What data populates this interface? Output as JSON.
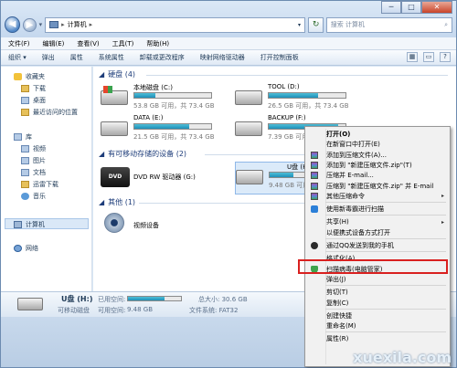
{
  "window": {
    "controls": {
      "minimize": "─",
      "maximize": "□",
      "close": "✕"
    }
  },
  "address": {
    "root": "▸",
    "path": "计算机",
    "arrow": "▾"
  },
  "search": {
    "placeholder": "搜索 计算机"
  },
  "menubar": [
    "文件(F)",
    "编辑(E)",
    "查看(V)",
    "工具(T)",
    "帮助(H)"
  ],
  "toolbar": [
    "组织 ▾",
    "弹出",
    "属性",
    "系统属性",
    "卸载或更改程序",
    "映射网络驱动器",
    "打开控制面板"
  ],
  "navpane": {
    "favorites": "收藏夹",
    "downloads": "下载",
    "desktop": "桌面",
    "recent": "最近访问的位置",
    "library": "库",
    "videos": "视频",
    "pictures": "图片",
    "docs": "文档",
    "xunlei": "迅雷下载",
    "music": "音乐",
    "computer": "计算机",
    "network": "网络"
  },
  "groups": {
    "hdd": "硬盘 (4)",
    "removable": "有可移动存储的设备 (2)",
    "other": "其他 (1)"
  },
  "drives": [
    {
      "name": "本地磁盘 (C:)",
      "size": "53.8 GB 可用，共 73.4 GB",
      "used": 0.27
    },
    {
      "name": "TOOL (D:)",
      "size": "26.5 GB 可用，共 73.4 GB",
      "used": 0.64
    },
    {
      "name": "DATA (E:)",
      "size": "21.5 GB 可用，共 73.4 GB",
      "used": 0.71
    },
    {
      "name": "BACKUP (F:)",
      "size": "7.39 GB 可用，",
      "used": 0.9
    }
  ],
  "removable": {
    "dvd": {
      "name": "DVD RW 驱动器 (G:)",
      "logo": "DVD"
    },
    "usb": {
      "name": "U盘 (H:)",
      "size": "9.48 GB 可用",
      "used": 0.31
    }
  },
  "other": {
    "webcam": "视频设备"
  },
  "details": {
    "name": "U盘 (H:)",
    "type": "可移动磁盘",
    "used_label": "已用空间:",
    "free_label": "可用空间:",
    "free_value": "9.48 GB",
    "total_label": "总大小: 30.6 GB",
    "fs_label": "文件系统: FAT32",
    "used_fraction": 0.69
  },
  "context_menu": [
    {
      "label": "打开(O)",
      "bold": true
    },
    {
      "label": "在新窗口中打开(E)"
    },
    {
      "label": "添加到压缩文件(A)...",
      "icon": "rar"
    },
    {
      "label": "添加到 \"新建压缩文件.zip\"(T)",
      "icon": "rar"
    },
    {
      "label": "压缩并 E-mail...",
      "icon": "rar"
    },
    {
      "label": "压缩到 \"新建压缩文件.zip\" 并 E-mail",
      "icon": "rar"
    },
    {
      "label": "其他压缩命令",
      "icon": "rar",
      "submenu": true
    },
    {
      "sep": true
    },
    {
      "label": "使用新毒霸进行扫描",
      "icon": "check"
    },
    {
      "sep": true
    },
    {
      "label": "共享(H)",
      "submenu": true
    },
    {
      "label": "以便携式设备方式打开"
    },
    {
      "sep": true
    },
    {
      "label": "通过QQ发送到我的手机",
      "icon": "qq"
    },
    {
      "sep": true
    },
    {
      "label": "格式化(A)..."
    },
    {
      "label": "扫描病毒(电脑管家)",
      "icon": "shield"
    },
    {
      "label": "弹出(J)"
    },
    {
      "sep": true
    },
    {
      "label": "剪切(T)"
    },
    {
      "label": "复制(C)"
    },
    {
      "sep": true
    },
    {
      "label": "创建快捷"
    },
    {
      "label": "重命名(M)"
    },
    {
      "sep": true
    },
    {
      "label": "属性(R)"
    }
  ],
  "submenu_arrow": "▸",
  "watermark": "xuexila.com",
  "colors": {
    "bar_fill": "#1e8fb8",
    "highlight_box": "#d9201f",
    "selection": "#dbeaf9"
  }
}
